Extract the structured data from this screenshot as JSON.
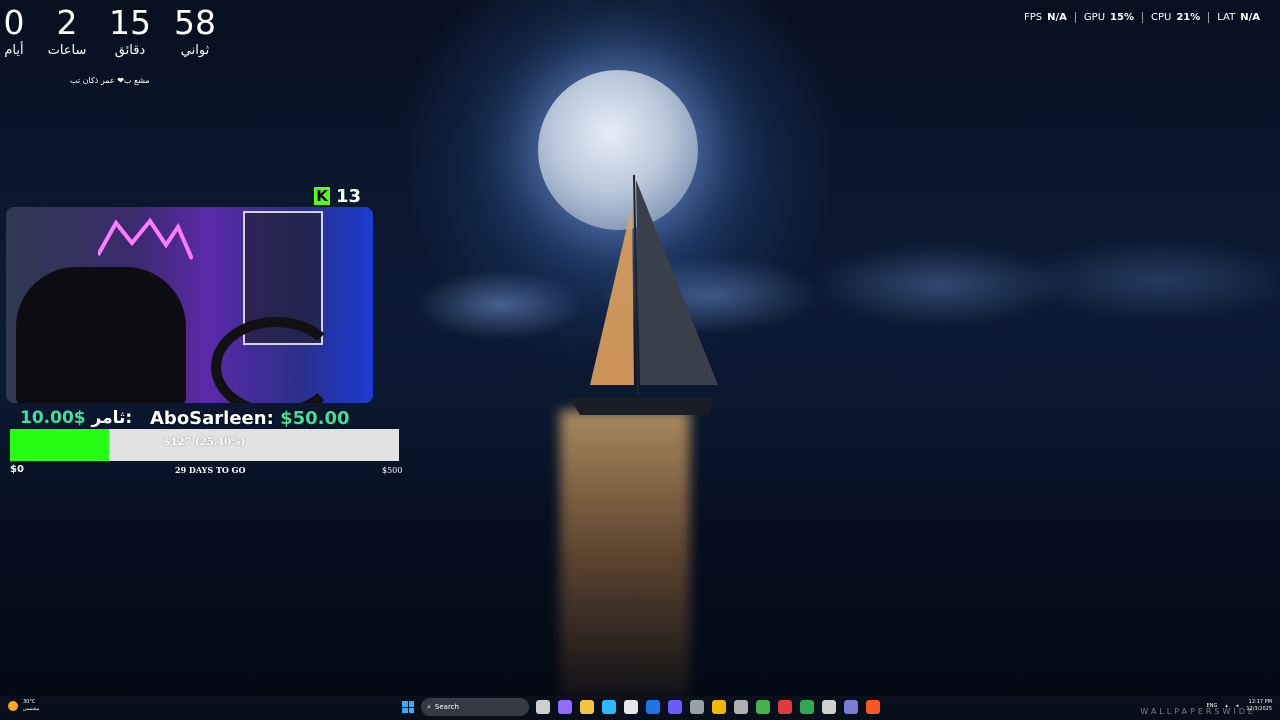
{
  "countdown": {
    "days": {
      "value": "0",
      "label": "أيام"
    },
    "hours": {
      "value": "2",
      "label": "ساعات"
    },
    "minutes": {
      "value": "15",
      "label": "دقائق"
    },
    "seconds": {
      "value": "58",
      "label": "ثواني"
    },
    "subtitle": "مشع ب❤ عمر ذكان تب"
  },
  "stats": [
    {
      "label": "FPS",
      "value": "N/A"
    },
    {
      "label": "GPU",
      "value": "15%"
    },
    {
      "label": "CPU",
      "value": "21%"
    },
    {
      "label": "LAT",
      "value": "N/A"
    }
  ],
  "stream": {
    "platform_icon": "kick-icon",
    "viewer_count": "13"
  },
  "donation": {
    "left_label": "ثامر:",
    "left_amount": "10.00$",
    "donor_name": "AboSarleen:",
    "donor_amount": "$50.00"
  },
  "goal": {
    "progress_text": "$127 (25.40%)",
    "progress_fraction": 0.254,
    "min_label": "$0",
    "days_left": "29 DAYS TO GO",
    "max_label": "$500",
    "fill_color": "#26ff13"
  },
  "taskbar": {
    "weather_temp": "30°C",
    "weather_desc": "مشمس",
    "search_placeholder": "Search",
    "lang": "ENG",
    "time": "12:17 PM",
    "date": "12/3/2025"
  },
  "watermark": "WALLPAPERSWIDE"
}
